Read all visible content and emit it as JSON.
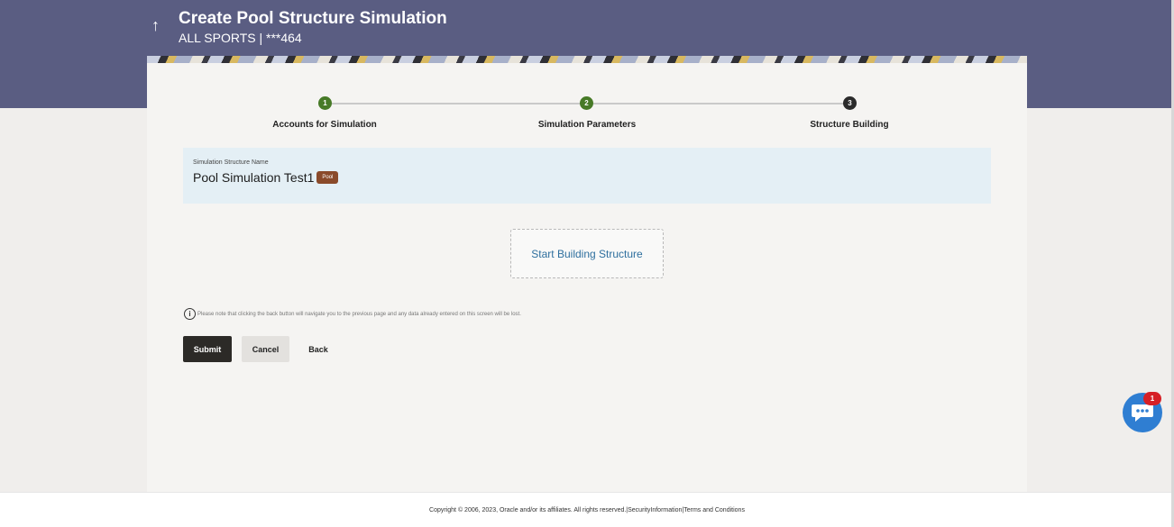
{
  "header": {
    "back_icon": "↑",
    "title": "Create Pool Structure Simulation",
    "subtitle": "ALL SPORTS | ***464"
  },
  "stepper": {
    "steps": [
      {
        "number": "1",
        "label": "Accounts for Simulation",
        "state": "done"
      },
      {
        "number": "2",
        "label": "Simulation Parameters",
        "state": "done"
      },
      {
        "number": "3",
        "label": "Structure Building",
        "state": "current"
      }
    ],
    "done_color": "#477a27",
    "current_color": "#2b2b2b"
  },
  "simulation": {
    "name_label": "Simulation Structure Name",
    "name_value": "Pool Simulation Test1",
    "badge": "Pool"
  },
  "start_building": {
    "label": "Start Building Structure"
  },
  "info": {
    "icon": "i",
    "note": "Please note that clicking the back button will navigate you to the previous page and any data already entered on this screen will be lost."
  },
  "actions": {
    "submit": "Submit",
    "cancel": "Cancel",
    "back": "Back"
  },
  "chat": {
    "badge_count": "1",
    "color": "#2f7ed2"
  },
  "footer": {
    "text": "Copyright © 2006, 2023, Oracle and/or its affiliates. All rights reserved.|SecurityInformation|Terms and Conditions"
  },
  "colors": {
    "header": "#5a5d82",
    "primary_button": "#2c2a27",
    "link": "#2e6f9e",
    "badge": "#8a4a2a"
  }
}
